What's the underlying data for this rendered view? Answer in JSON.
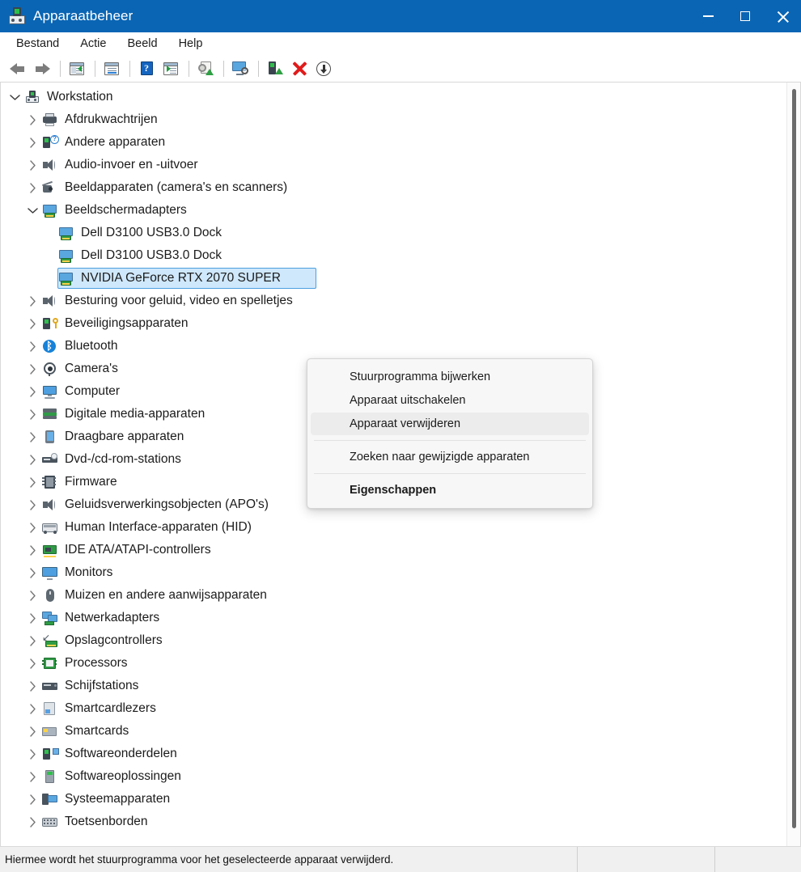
{
  "window": {
    "title": "Apparaatbeheer",
    "icon": "device-manager-icon",
    "accent_color": "#0a65b4",
    "controls": {
      "minimize": "minimize-icon",
      "maximize": "maximize-icon",
      "close": "close-icon"
    }
  },
  "menubar": {
    "items": [
      {
        "label": "Bestand"
      },
      {
        "label": "Actie"
      },
      {
        "label": "Beeld"
      },
      {
        "label": "Help"
      }
    ]
  },
  "toolbar": {
    "buttons": [
      {
        "icon": "back-arrow-icon",
        "group": 0
      },
      {
        "icon": "forward-arrow-icon",
        "group": 0
      },
      {
        "icon": "show-hide-console-tree-icon",
        "group": 1
      },
      {
        "icon": "properties-icon",
        "group": 2
      },
      {
        "icon": "help-icon",
        "group": 3
      },
      {
        "icon": "scan-action-icon",
        "group": 3
      },
      {
        "icon": "update-driver-icon",
        "group": 4
      },
      {
        "icon": "scan-for-hardware-changes-icon",
        "group": 5
      },
      {
        "icon": "enable-device-icon",
        "group": 6
      },
      {
        "icon": "uninstall-device-icon",
        "group": 6
      },
      {
        "icon": "disable-device-icon",
        "group": 6
      }
    ]
  },
  "tree": {
    "rows": [
      {
        "label": "Workstation",
        "level": 0,
        "twist": "expanded",
        "icon": "i-workstation",
        "selected": false
      },
      {
        "label": "Afdrukwachtrijen",
        "level": 1,
        "twist": "collapsed",
        "icon": "i-printer",
        "selected": false
      },
      {
        "label": "Andere apparaten",
        "level": 1,
        "twist": "collapsed",
        "icon": "i-other",
        "selected": false
      },
      {
        "label": "Audio-invoer en -uitvoer",
        "level": 1,
        "twist": "collapsed",
        "icon": "i-speaker",
        "selected": false
      },
      {
        "label": "Beeldapparaten (camera's en scanners)",
        "level": 1,
        "twist": "collapsed",
        "icon": "i-camera",
        "selected": false
      },
      {
        "label": "Beeldschermadapters",
        "level": 1,
        "twist": "expanded",
        "icon": "i-display",
        "selected": false
      },
      {
        "label": "Dell D3100 USB3.0 Dock",
        "level": 2,
        "twist": "none",
        "icon": "i-display",
        "selected": false
      },
      {
        "label": "Dell D3100 USB3.0 Dock",
        "level": 2,
        "twist": "none",
        "icon": "i-display",
        "selected": false
      },
      {
        "label": "NVIDIA GeForce RTX 2070 SUPER",
        "level": 2,
        "twist": "none",
        "icon": "i-display",
        "selected": true
      },
      {
        "label": "Besturing voor geluid, video en spelletjes",
        "level": 1,
        "twist": "collapsed",
        "icon": "i-speaker",
        "selected": false
      },
      {
        "label": "Beveiligingsapparaten",
        "level": 1,
        "twist": "collapsed",
        "icon": "i-seclock",
        "selected": false
      },
      {
        "label": "Bluetooth",
        "level": 1,
        "twist": "collapsed",
        "icon": "i-bt",
        "selected": false
      },
      {
        "label": "Camera's",
        "level": 1,
        "twist": "collapsed",
        "icon": "i-webcam",
        "selected": false
      },
      {
        "label": "Computer",
        "level": 1,
        "twist": "collapsed",
        "icon": "i-computer",
        "selected": false
      },
      {
        "label": "Digitale media-apparaten",
        "level": 1,
        "twist": "collapsed",
        "icon": "i-media",
        "selected": false
      },
      {
        "label": "Draagbare apparaten",
        "level": 1,
        "twist": "collapsed",
        "icon": "i-portable",
        "selected": false
      },
      {
        "label": "Dvd-/cd-rom-stations",
        "level": 1,
        "twist": "collapsed",
        "icon": "i-dvd",
        "selected": false
      },
      {
        "label": "Firmware",
        "level": 1,
        "twist": "collapsed",
        "icon": "i-firmware",
        "selected": false
      },
      {
        "label": "Geluidsverwerkingsobjecten (APO's)",
        "level": 1,
        "twist": "collapsed",
        "icon": "i-speaker",
        "selected": false
      },
      {
        "label": "Human Interface-apparaten (HID)",
        "level": 1,
        "twist": "collapsed",
        "icon": "i-hid",
        "selected": false
      },
      {
        "label": "IDE ATA/ATAPI-controllers",
        "level": 1,
        "twist": "collapsed",
        "icon": "i-ide",
        "selected": false
      },
      {
        "label": "Monitors",
        "level": 1,
        "twist": "collapsed",
        "icon": "i-monitor",
        "selected": false
      },
      {
        "label": "Muizen en andere aanwijsapparaten",
        "level": 1,
        "twist": "collapsed",
        "icon": "i-mouse",
        "selected": false
      },
      {
        "label": "Netwerkadapters",
        "level": 1,
        "twist": "collapsed",
        "icon": "i-net",
        "selected": false
      },
      {
        "label": "Opslagcontrollers",
        "level": 1,
        "twist": "collapsed",
        "icon": "i-storage",
        "selected": false
      },
      {
        "label": "Processors",
        "level": 1,
        "twist": "collapsed",
        "icon": "i-cpu",
        "selected": false
      },
      {
        "label": "Schijfstations",
        "level": 1,
        "twist": "collapsed",
        "icon": "i-drive",
        "selected": false
      },
      {
        "label": "Smartcardlezers",
        "level": 1,
        "twist": "collapsed",
        "icon": "i-scard",
        "selected": false
      },
      {
        "label": "Smartcards",
        "level": 1,
        "twist": "collapsed",
        "icon": "i-scards",
        "selected": false
      },
      {
        "label": "Softwareonderdelen",
        "level": 1,
        "twist": "collapsed",
        "icon": "i-swcomp",
        "selected": false
      },
      {
        "label": "Softwareoplossingen",
        "level": 1,
        "twist": "collapsed",
        "icon": "i-swsol",
        "selected": false
      },
      {
        "label": "Systeemapparaten",
        "level": 1,
        "twist": "collapsed",
        "icon": "i-system",
        "selected": false
      },
      {
        "label": "Toetsenborden",
        "level": 1,
        "twist": "collapsed",
        "icon": "i-kbd",
        "selected": false
      }
    ],
    "selection_highlight_color": "#cfe8fb",
    "selection_border_color": "#4c9fe0"
  },
  "context_menu": {
    "items": [
      {
        "label": "Stuurprogramma bijwerken",
        "state": "normal"
      },
      {
        "label": "Apparaat uitschakelen",
        "state": "normal"
      },
      {
        "label": "Apparaat verwijderen",
        "state": "hover"
      },
      {
        "separator": true
      },
      {
        "label": "Zoeken naar gewijzigde apparaten",
        "state": "normal"
      },
      {
        "separator": true
      },
      {
        "label": "Eigenschappen",
        "state": "bold"
      }
    ],
    "hover_color": "#ececec"
  },
  "statusbar": {
    "message": "Hiermee wordt het stuurprogramma voor het geselecteerde apparaat verwijderd.",
    "pane2": "",
    "pane3": ""
  }
}
